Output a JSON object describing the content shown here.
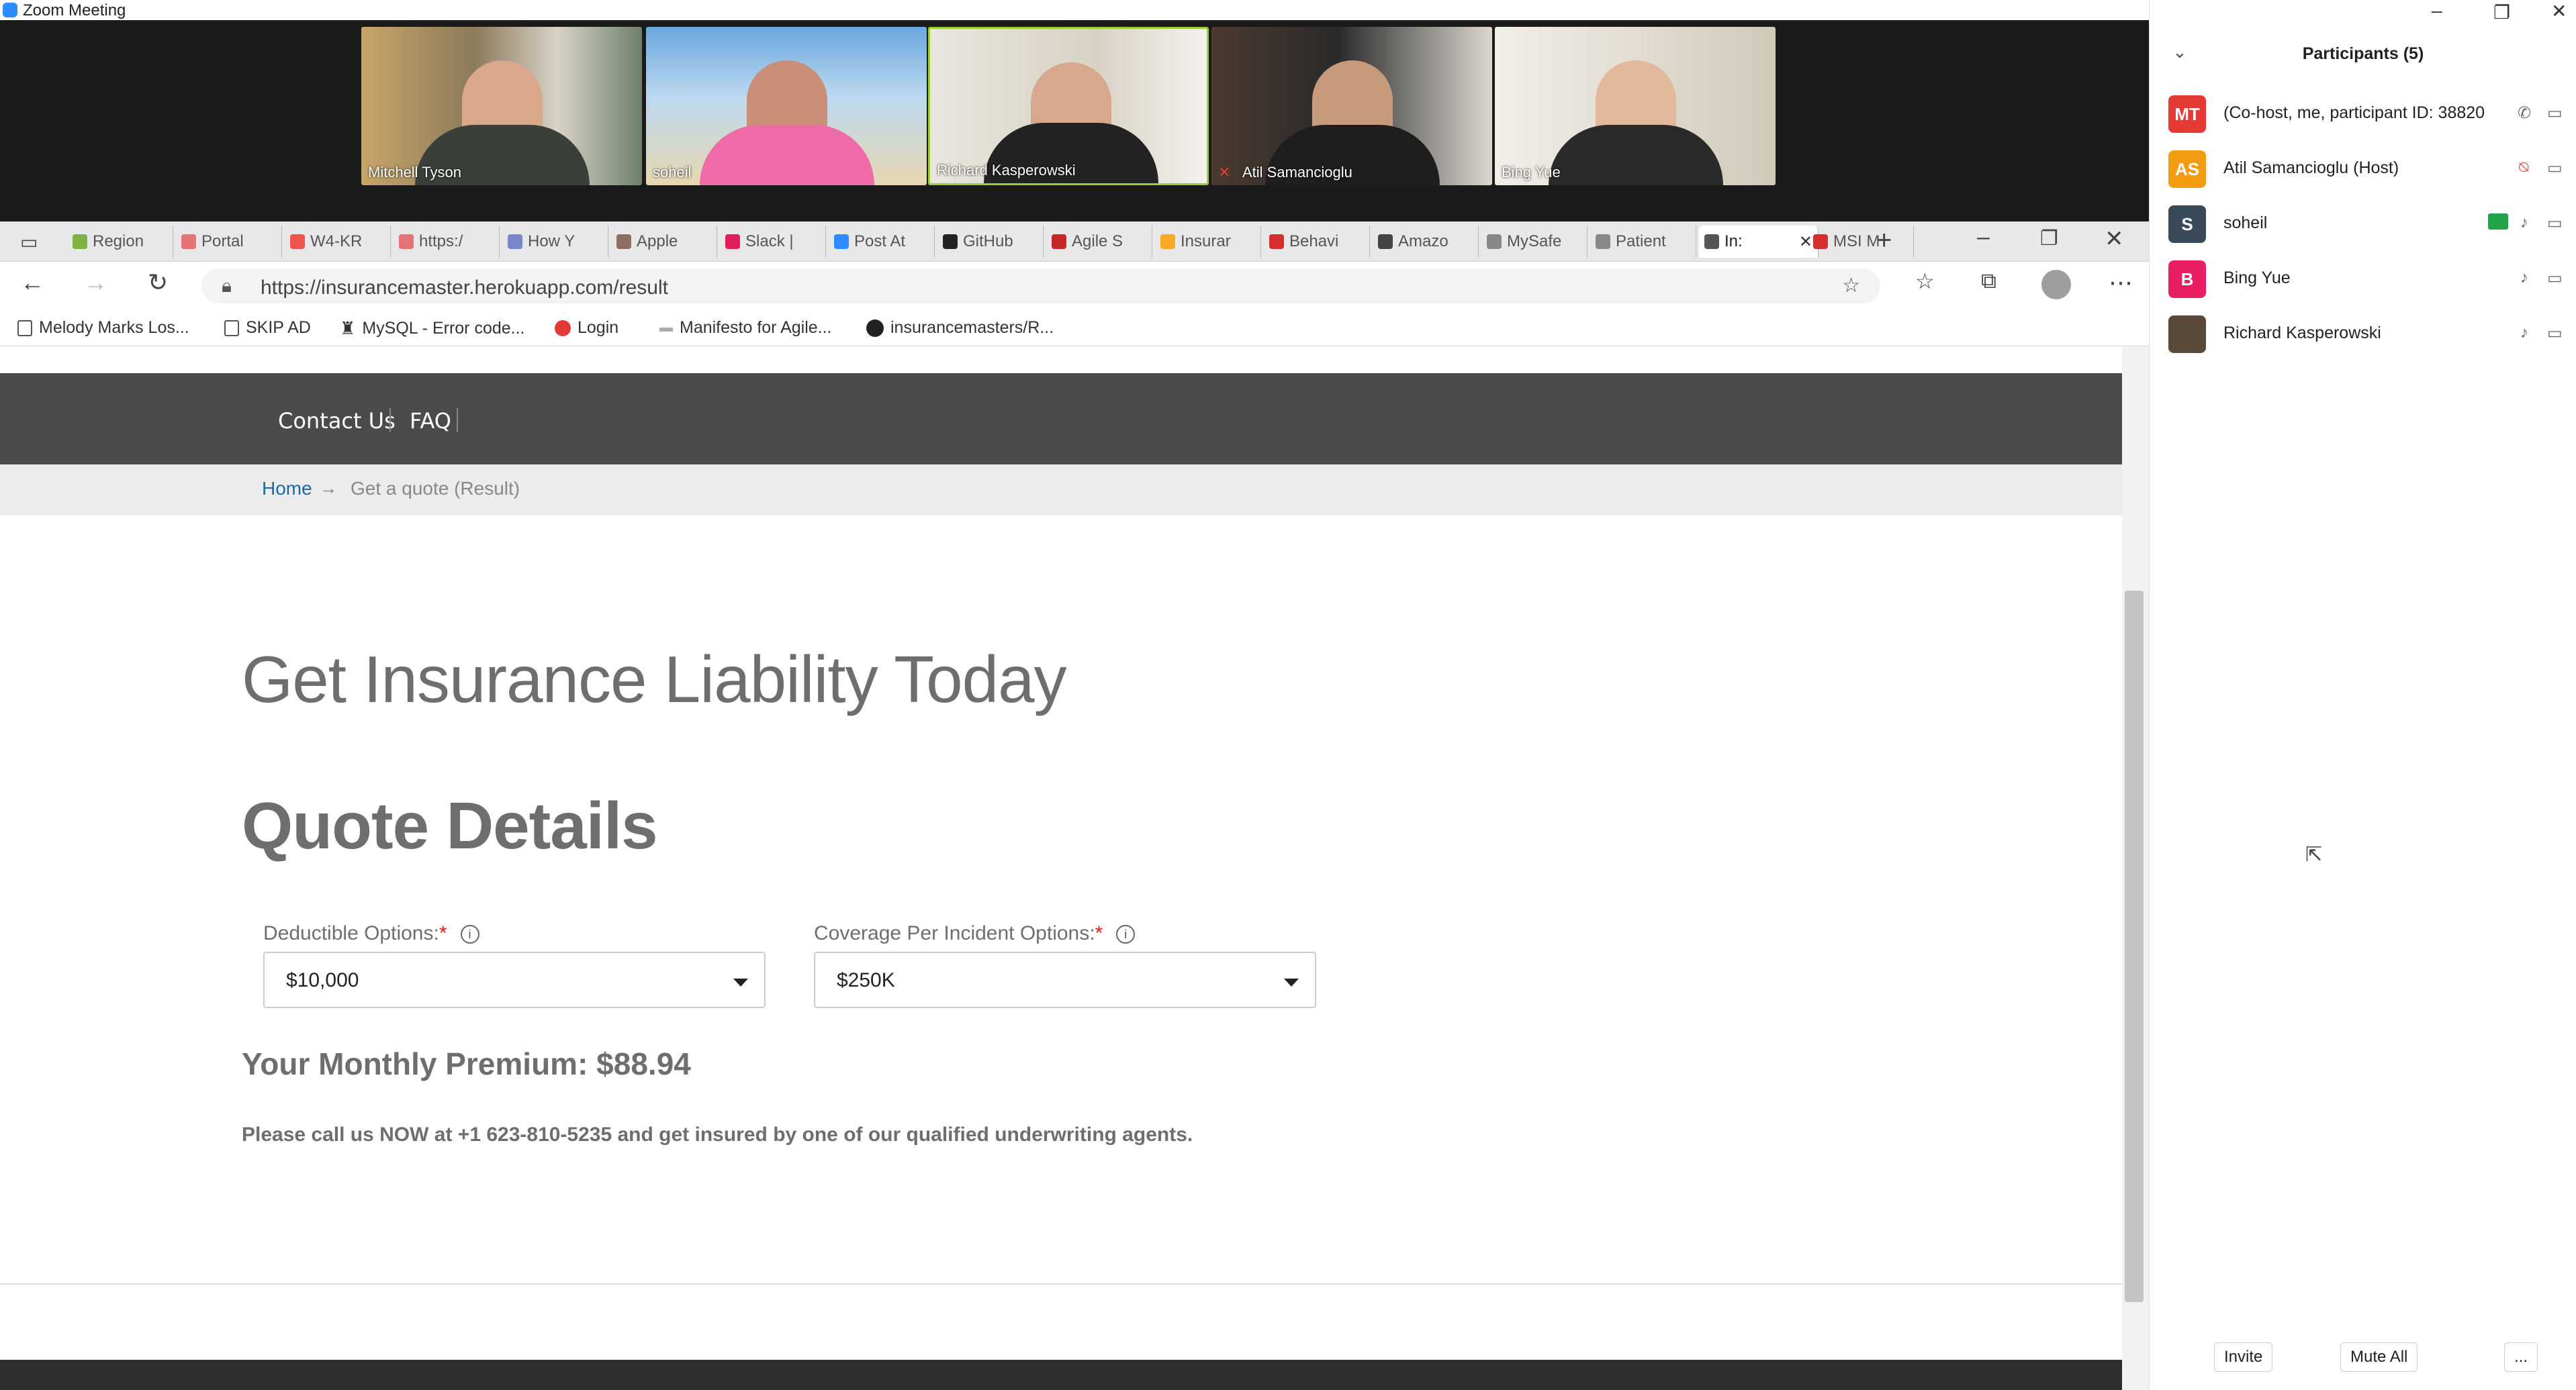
{
  "zoom": {
    "window_title": "Zoom Meeting",
    "videos": [
      {
        "name": "Mitchell Tyson"
      },
      {
        "name": "soheil"
      },
      {
        "name": "Richard Kasperowski"
      },
      {
        "name": "Atil Samancioglu"
      },
      {
        "name": "Bing Yue"
      }
    ],
    "participants_title": "Participants (5)",
    "participants": [
      {
        "initials": "MT",
        "name": "(Co-host, me, participant ID: 38820",
        "color": "#e53935"
      },
      {
        "initials": "AS",
        "name": "Atil Samancioglu (Host)",
        "color": "#f39c12"
      },
      {
        "initials": "S",
        "name": "soheil",
        "color": "#3b4a5a"
      },
      {
        "initials": "B",
        "name": "Bing Yue",
        "color": "#e91e63"
      },
      {
        "initials": "",
        "name": "Richard Kasperowski",
        "color": "#5a4a3a"
      }
    ],
    "invite_label": "Invite",
    "mute_all_label": "Mute All",
    "more_label": "..."
  },
  "browser": {
    "tabs": [
      {
        "label": "Region",
        "color": "#7cb342"
      },
      {
        "label": "Portal",
        "color": "#e57373"
      },
      {
        "label": "W4-KR",
        "color": "#ef5350"
      },
      {
        "label": "https:/",
        "color": "#e57373"
      },
      {
        "label": "How Y",
        "color": "#7986cb"
      },
      {
        "label": "Apple",
        "color": "#8d6e63"
      },
      {
        "label": "Slack |",
        "color": "#e01e5a"
      },
      {
        "label": "Post At",
        "color": "#2d8cff"
      },
      {
        "label": "GitHub",
        "color": "#222222"
      },
      {
        "label": "Agile S",
        "color": "#c62828"
      },
      {
        "label": "Insurar",
        "color": "#f9a825"
      },
      {
        "label": "Behavi",
        "color": "#d32f2f"
      },
      {
        "label": "Amazo",
        "color": "#444444"
      },
      {
        "label": "MySafe",
        "color": "#888888"
      },
      {
        "label": "Patient",
        "color": "#888888"
      },
      {
        "label": "In:",
        "color": "#555555"
      },
      {
        "label": "MSI M",
        "color": "#d32f2f"
      }
    ],
    "url": "https://insurancemaster.herokuapp.com/result",
    "bookmarks": [
      {
        "label": "Melody Marks Los..."
      },
      {
        "label": "SKIP AD"
      },
      {
        "label": "MySQL - Error code..."
      },
      {
        "label": "Login"
      },
      {
        "label": "Manifesto for Agile..."
      },
      {
        "label": "insurancemasters/R..."
      }
    ]
  },
  "page": {
    "nav": {
      "contact": "Contact Us",
      "faq": "FAQ"
    },
    "breadcrumb": {
      "home": "Home",
      "arrow": "→",
      "current": "Get a quote (Result)"
    },
    "hero_title": "Get Insurance Liability Today",
    "section_title": "Quote Details",
    "deductible": {
      "label": "Deductible Options:",
      "required": "*",
      "value": "$10,000"
    },
    "coverage": {
      "label": "Coverage Per Incident Options:",
      "required": "*",
      "value": "$250K"
    },
    "premium": "Your Monthly Premium: $88.94",
    "callout": "Please call us NOW at +1 623-810-5235 and get insured by one of our qualified underwriting agents."
  }
}
